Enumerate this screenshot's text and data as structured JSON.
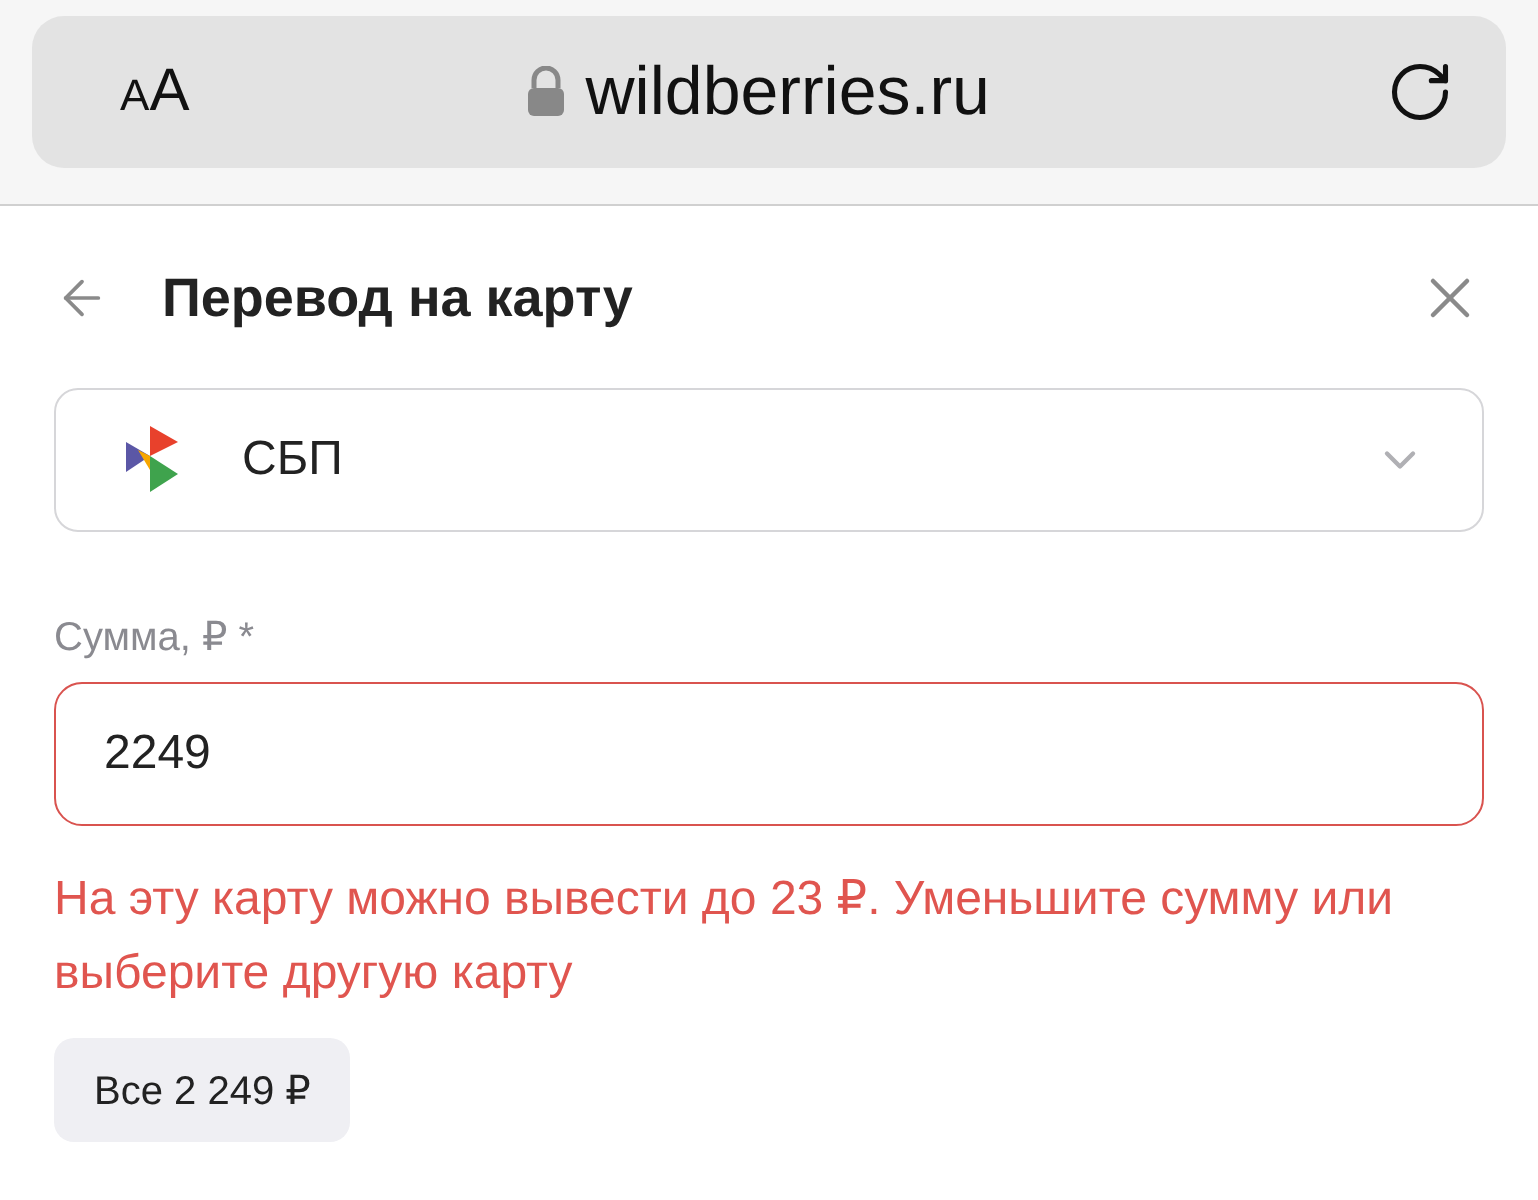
{
  "browser": {
    "text_size_button": "AA",
    "secure": true,
    "address": "wildberries.ru"
  },
  "header": {
    "title": "Перевод на карту"
  },
  "method_select": {
    "value": "СБП"
  },
  "amount": {
    "label": "Сумма, ₽ *",
    "value": "2249",
    "error": true,
    "error_text": "На эту карту можно вывести до 23 ₽. Уменьшите сумму или выберите другую карту"
  },
  "all_button": "Все 2 249 ₽"
}
